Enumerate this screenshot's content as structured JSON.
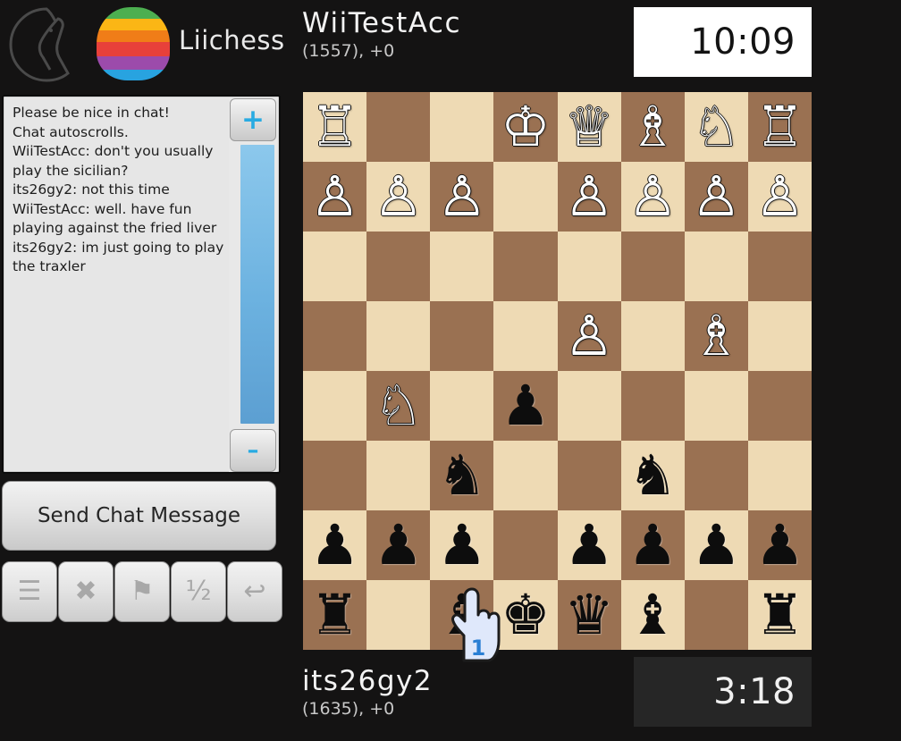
{
  "brand": {
    "name": "Liichess",
    "horse_icon": "horse-head-outline-icon",
    "logo_icon": "rainbow-circle-logo",
    "rainbow_colors": [
      "#4caf50",
      "#fbb615",
      "#f07d18",
      "#e8403a",
      "#9c4bab",
      "#28a3e0"
    ]
  },
  "chat": {
    "lines": [
      "Please be nice in chat!",
      "Chat autoscrolls.",
      "WiiTestAcc: don't you usually play the sicilian?",
      "its26gy2: not this time",
      "WiiTestAcc: well. have fun playing against the fried liver",
      "its26gy2: im just going to play the traxler"
    ],
    "scroll_up_label": "+",
    "scroll_down_label": "–",
    "send_button_label": "Send Chat Message"
  },
  "toolbar": {
    "buttons": [
      {
        "name": "menu-button",
        "glyph": "☰",
        "icon": "hamburger-menu-icon"
      },
      {
        "name": "abort-button",
        "glyph": "✖",
        "icon": "close-x-icon"
      },
      {
        "name": "resign-button",
        "glyph": "⚑",
        "icon": "flag-icon"
      },
      {
        "name": "draw-offer-button",
        "glyph": "½",
        "icon": "half-fraction-icon"
      },
      {
        "name": "takeback-button",
        "glyph": "↩",
        "icon": "back-arrow-icon"
      }
    ]
  },
  "players": {
    "top": {
      "name": "WiiTestAcc",
      "rating_line": "(1557), +0",
      "clock": "10:09",
      "clock_active": true
    },
    "bottom": {
      "name": "its26gy2",
      "rating_line": "(1635), +0",
      "clock": "3:18",
      "clock_active": false
    }
  },
  "cursor": {
    "icon": "wii-pointer-hand-icon",
    "player_number": "1"
  },
  "board": {
    "light_square_color": "#eedab4",
    "dark_square_color": "#9a7152",
    "orientation": "white-on-top",
    "ranks": [
      [
        "wR",
        "",
        "",
        "wK",
        "wQ",
        "wB",
        "wN",
        "wR"
      ],
      [
        "wP",
        "wP",
        "wP",
        "",
        "wP",
        "wP",
        "wP",
        "wP"
      ],
      [
        "",
        "",
        "",
        "",
        "",
        "",
        "",
        ""
      ],
      [
        "",
        "",
        "",
        "",
        "wP",
        "",
        "wB",
        ""
      ],
      [
        "",
        "wN",
        "",
        "bP",
        "",
        "",
        "",
        ""
      ],
      [
        "",
        "",
        "bN",
        "",
        "",
        "bN",
        "",
        ""
      ],
      [
        "bP",
        "bP",
        "bP",
        "",
        "bP",
        "bP",
        "bP",
        "bP"
      ],
      [
        "bR",
        "",
        "bB",
        "bK",
        "bQ",
        "bB",
        "",
        "bR"
      ]
    ],
    "glyphs": {
      "wK": "♔",
      "wQ": "♕",
      "wR": "♖",
      "wB": "♗",
      "wN": "♘",
      "wP": "♙",
      "bK": "♚",
      "bQ": "♛",
      "bR": "♜",
      "bB": "♝",
      "bN": "♞",
      "bP": "♟"
    }
  }
}
